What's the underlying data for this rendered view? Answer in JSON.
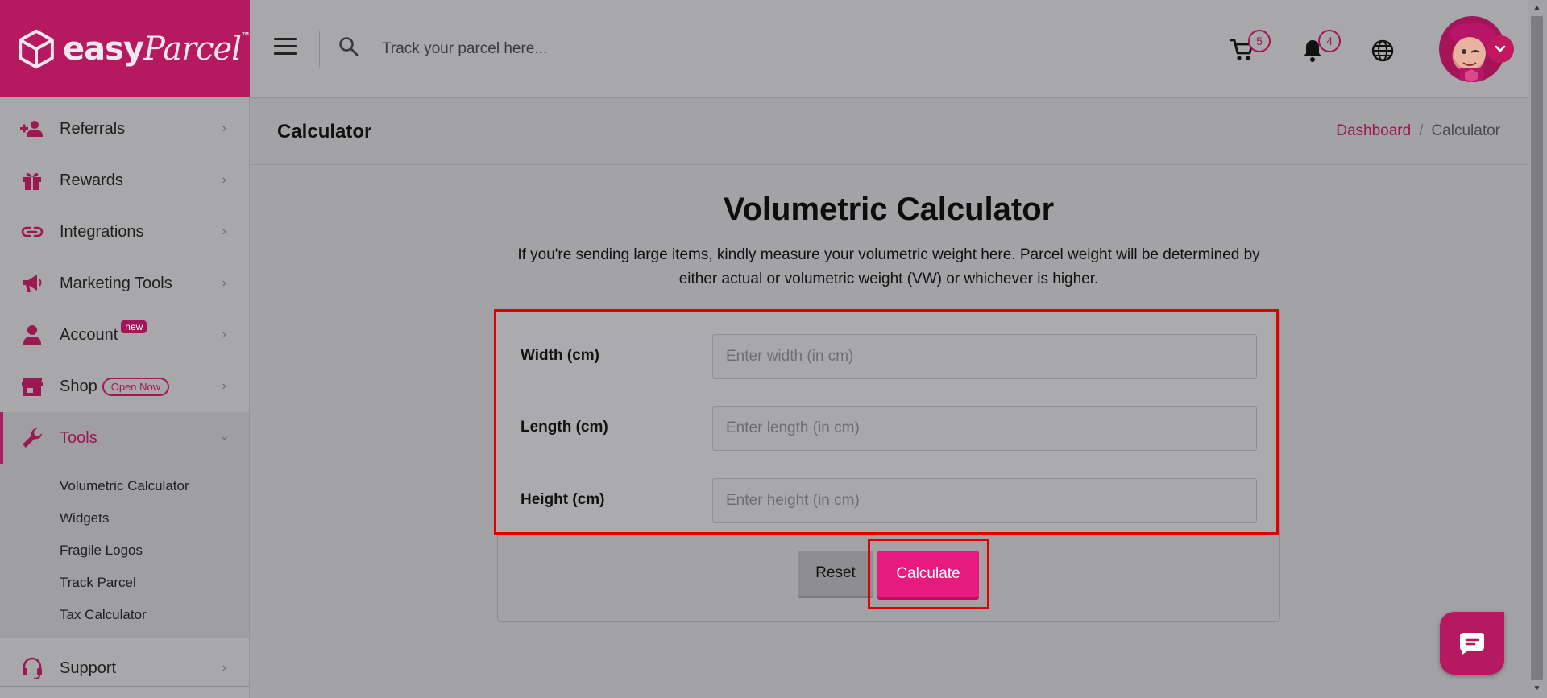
{
  "brand": {
    "name_bold": "easy",
    "name_script": "Parcel",
    "tm": "™"
  },
  "topbar": {
    "search_placeholder": "Track your parcel here...",
    "cart_count": "5",
    "notification_count": "4"
  },
  "sidebar": {
    "items": [
      {
        "label": "Referrals",
        "icon": "referrals-icon"
      },
      {
        "label": "Rewards",
        "icon": "gift-icon"
      },
      {
        "label": "Integrations",
        "icon": "link-icon"
      },
      {
        "label": "Marketing Tools",
        "icon": "megaphone-icon"
      },
      {
        "label": "Account",
        "icon": "user-icon",
        "badge": "new"
      },
      {
        "label": "Shop",
        "icon": "store-icon",
        "badge": "Open Now"
      },
      {
        "label": "Tools",
        "icon": "wrench-icon"
      }
    ],
    "tools_sub": [
      "Volumetric Calculator",
      "Widgets",
      "Fragile Logos",
      "Track Parcel",
      "Tax Calculator"
    ],
    "support": {
      "label": "Support",
      "icon": "headset-icon"
    }
  },
  "page_header": {
    "title": "Calculator",
    "breadcrumb": {
      "home": "Dashboard",
      "separator": "/",
      "current": "Calculator"
    }
  },
  "calculator": {
    "title": "Volumetric Calculator",
    "description": "If you're sending large items, kindly measure your volumetric weight here. Parcel weight will be determined by either actual or volumetric weight (VW) or whichever is higher.",
    "fields": [
      {
        "label": "Width (cm)",
        "placeholder": "Enter width (in cm)"
      },
      {
        "label": "Length (cm)",
        "placeholder": "Enter length (in cm)"
      },
      {
        "label": "Height (cm)",
        "placeholder": "Enter height (in cm)"
      }
    ],
    "reset_label": "Reset",
    "calculate_label": "Calculate"
  },
  "colors": {
    "brand": "#b5195f",
    "accent": "#e8197f",
    "highlight": "#e00000"
  }
}
